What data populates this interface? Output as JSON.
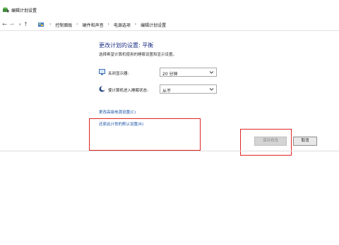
{
  "window": {
    "title": "编辑计划设置"
  },
  "breadcrumb": [
    "控制面板",
    "硬件和声音",
    "电源选项",
    "编辑计划设置"
  ],
  "main": {
    "heading": "更改计划的设置: 平衡",
    "subtitle": "选择希望计算机使用的睡眠设置和显示设置。",
    "settings": [
      {
        "label": "关闭显示器:",
        "value": "20 分钟",
        "icon": "monitor-icon"
      },
      {
        "label": "使计算机进入睡眠状态:",
        "value": "从不",
        "icon": "moon-icon"
      }
    ],
    "links": {
      "advanced": "更改高级电源设置(C)",
      "restore": "还原此计划的默认设置(R)"
    }
  },
  "buttons": {
    "save": "保存修改",
    "cancel": "取消"
  },
  "colors": {
    "heading": "#1e3287",
    "link": "#1a53a8",
    "highlight": "#e02424"
  }
}
